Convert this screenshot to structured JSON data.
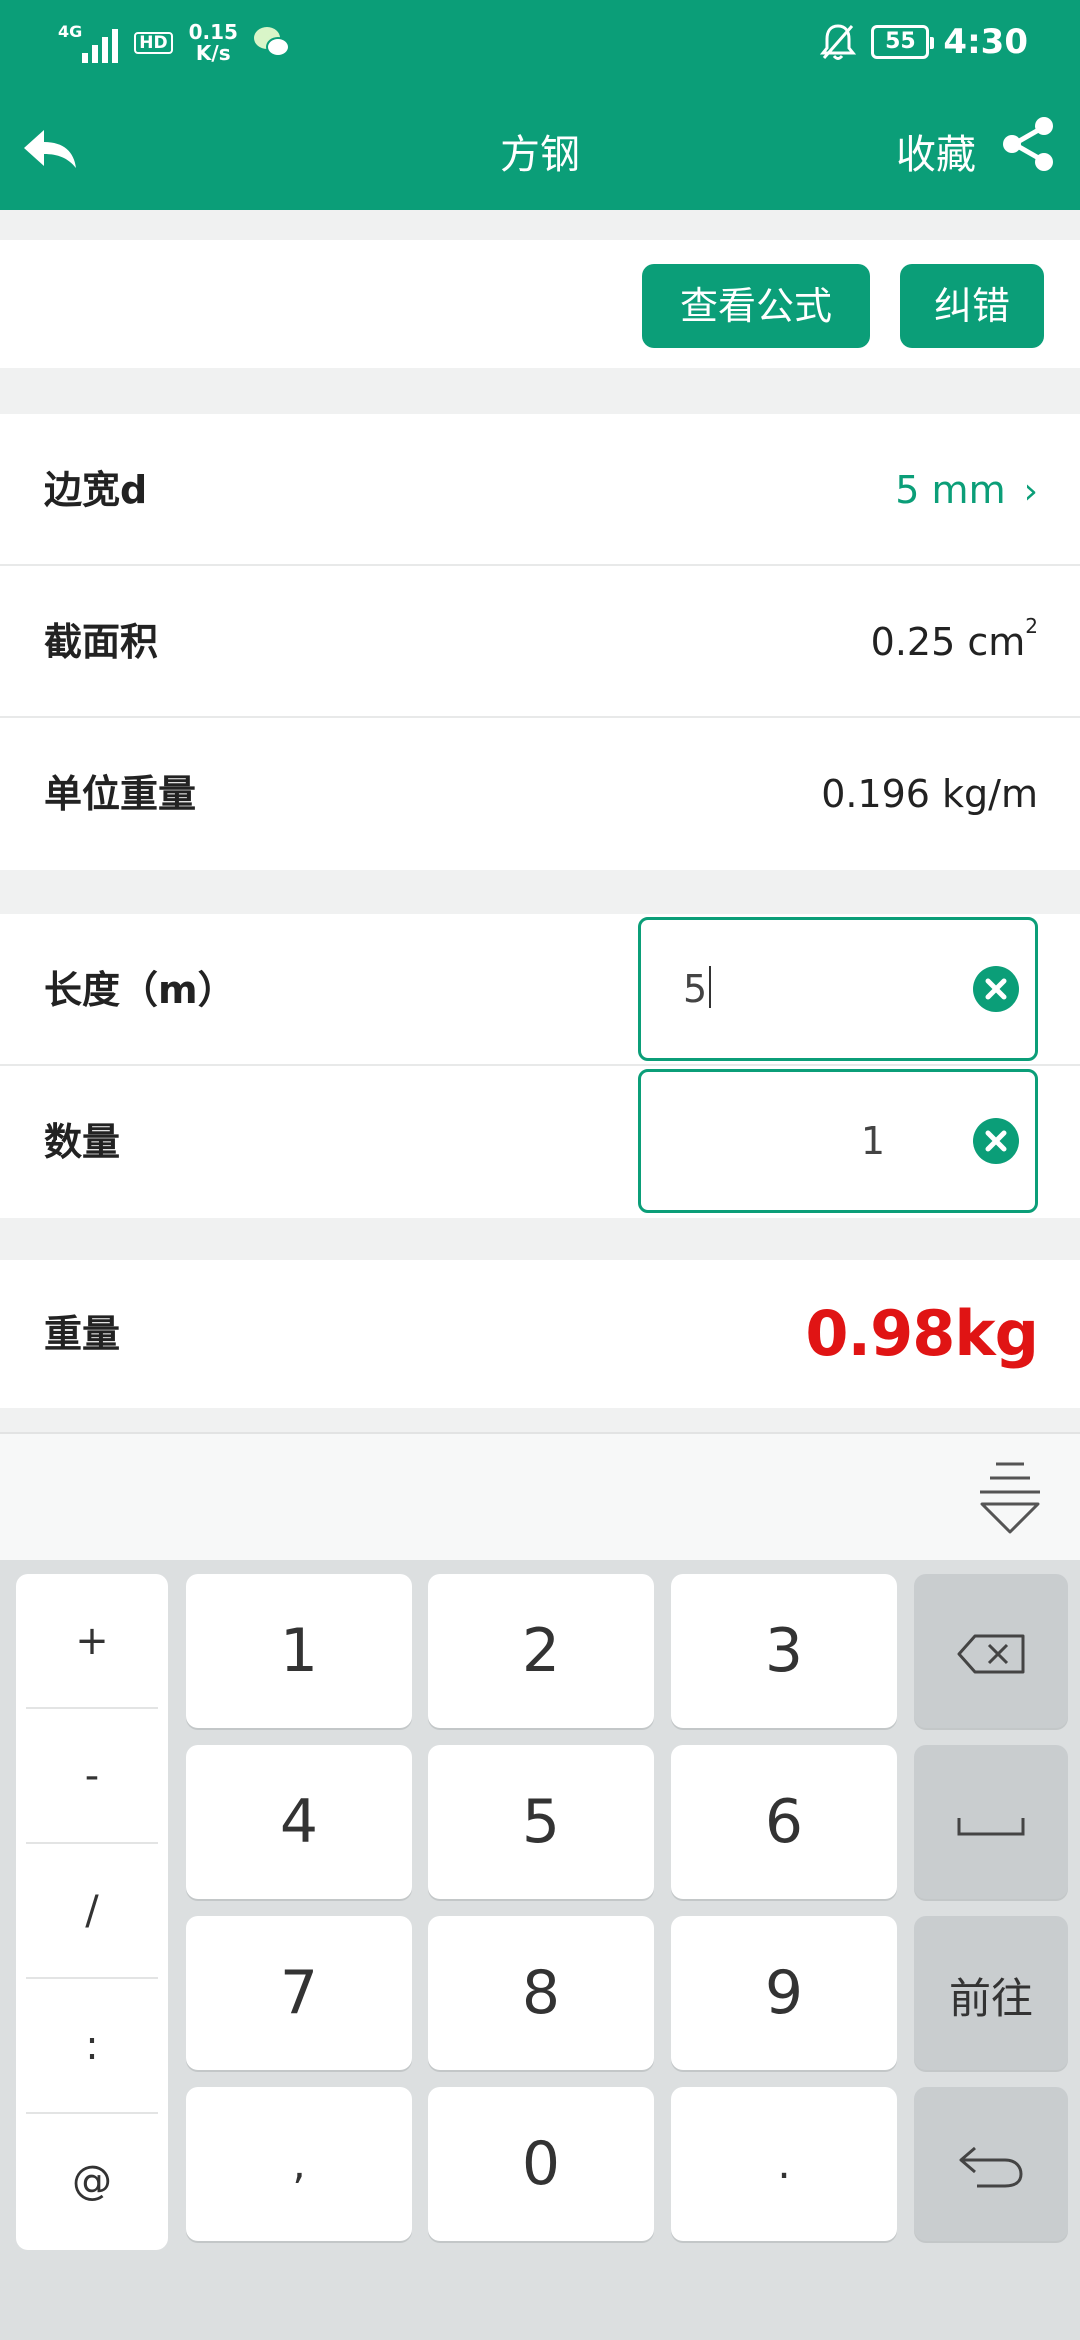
{
  "status_bar": {
    "network": "4G",
    "hd": "HD",
    "speed_value": "0.15",
    "speed_unit": "K/s",
    "battery": "55",
    "time": "4:30"
  },
  "nav": {
    "title": "方钢",
    "favorite_label": "收藏"
  },
  "actions": {
    "formula_label": "查看公式",
    "correct_label": "纠错"
  },
  "specs": {
    "side_width_label": "边宽d",
    "side_width_value": "5 mm",
    "area_label": "截面积",
    "area_value": "0.25 cm",
    "area_unit_sup": "2",
    "unit_weight_label": "单位重量",
    "unit_weight_value": "0.196 kg/m"
  },
  "inputs": {
    "length_label": "长度（m）",
    "length_value": "5",
    "quantity_label": "数量",
    "quantity_value": "1"
  },
  "result": {
    "weight_label": "重量",
    "weight_value": "0.98kg"
  },
  "keyboard": {
    "symbols": [
      "+",
      "-",
      "/",
      ":",
      "@"
    ],
    "digits": [
      "1",
      "2",
      "3",
      "4",
      "5",
      "6",
      "7",
      "8",
      "9",
      ",",
      "0",
      "."
    ],
    "go_label": "前往"
  },
  "colors": {
    "brand": "#0b9e78",
    "result": "#e01414"
  }
}
